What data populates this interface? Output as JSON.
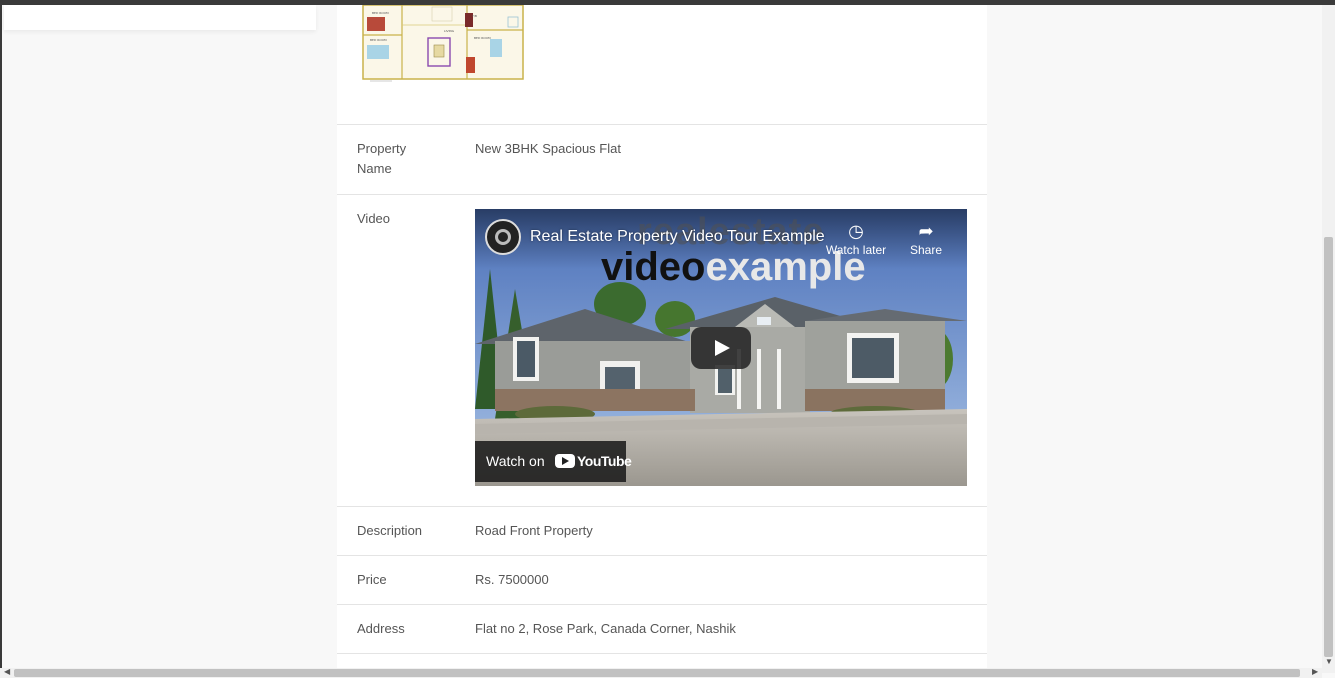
{
  "details": {
    "property_name_label": "Property\nName",
    "property_name_value": "New 3BHK Spacious Flat",
    "video_label": "Video",
    "description_label": "Description",
    "description_value": "Road Front Property",
    "price_label": "Price",
    "price_value": "Rs. 7500000",
    "address_label": "Address",
    "address_value": "Flat no 2, Rose Park, Canada Corner, Nashik"
  },
  "video": {
    "title": "Real Estate Property Video Tour Example",
    "watch_later_label": "Watch later",
    "share_label": "Share",
    "watch_on_label": "Watch on",
    "youtube_word": "YouTube",
    "watermark_line1": "realestate",
    "watermark_line2_dark": "video",
    "watermark_line2_light": "example",
    "watch_later_icon": "clock-icon",
    "share_icon": "share-arrow-icon"
  },
  "colors": {
    "page_bg": "#f8f8f8",
    "panel_bg": "#ffffff",
    "divider": "#e4e4e4",
    "text": "#555555"
  }
}
